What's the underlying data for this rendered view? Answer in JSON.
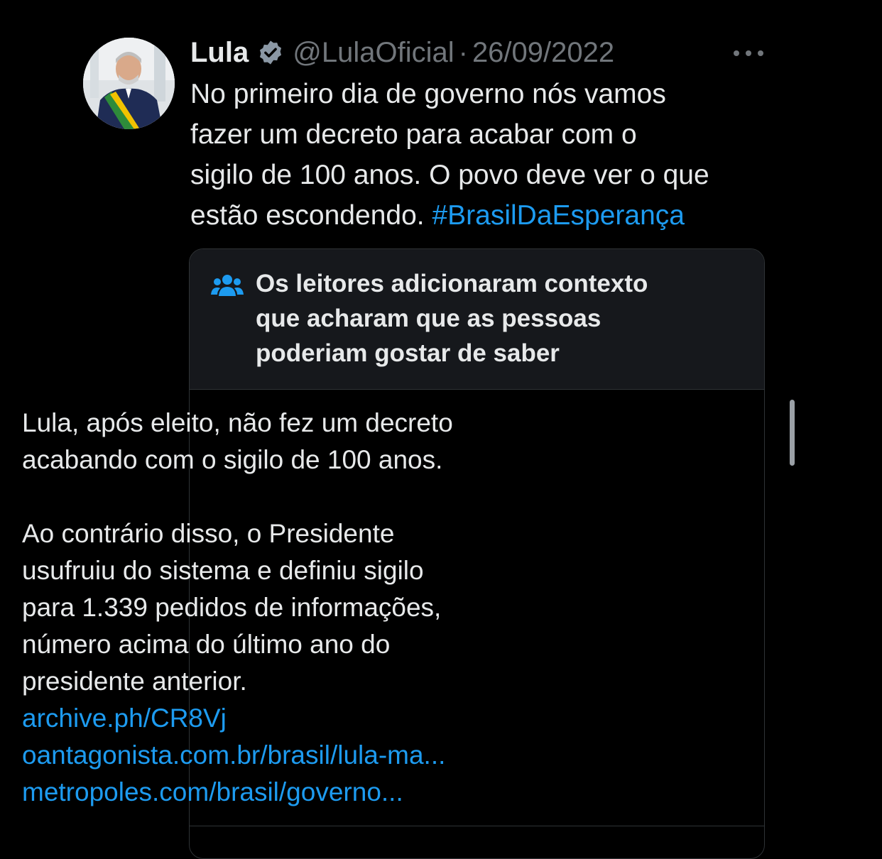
{
  "tweet": {
    "author": {
      "name": "Lula",
      "handle": "@LulaOficial",
      "avatar": "presidential-portrait-avatar"
    },
    "separator": "·",
    "date": "26/09/2022",
    "text_lines": [
      "No primeiro dia de governo nós vamos",
      "fazer um decreto para acabar com o",
      "sigilo de 100 anos. O povo deve ver o que",
      "estão escondendo."
    ],
    "hashtag": "#BrasilDaEsperança",
    "icons": {
      "verified": "verified-badge-icon",
      "more": "more-options-icon"
    }
  },
  "community_note": {
    "icon": "people-icon",
    "title_lines": [
      "Os leitores adicionaram contexto",
      "que acharam que as pessoas",
      "poderiam gostar de saber"
    ],
    "paragraph_1": [
      "Lula, após eleito, não fez um decreto",
      "acabando com o sigilo de 100 anos."
    ],
    "paragraph_2": [
      "Ao contrário disso, o Presidente",
      "usufruiu do sistema e definiu sigilo",
      "para 1.339 pedidos de informações,",
      "número acima do último ano do",
      "presidente anterior."
    ],
    "links": [
      "archive.ph/CR8Vj",
      "oantagonista.com.br/brasil/lula-ma...",
      "metropoles.com/brasil/governo..."
    ]
  },
  "colors": {
    "background": "#000000",
    "text": "#e7e9ea",
    "muted": "#71767b",
    "link": "#1d9bf0",
    "card_header": "#16181c",
    "border": "#2f3336"
  }
}
